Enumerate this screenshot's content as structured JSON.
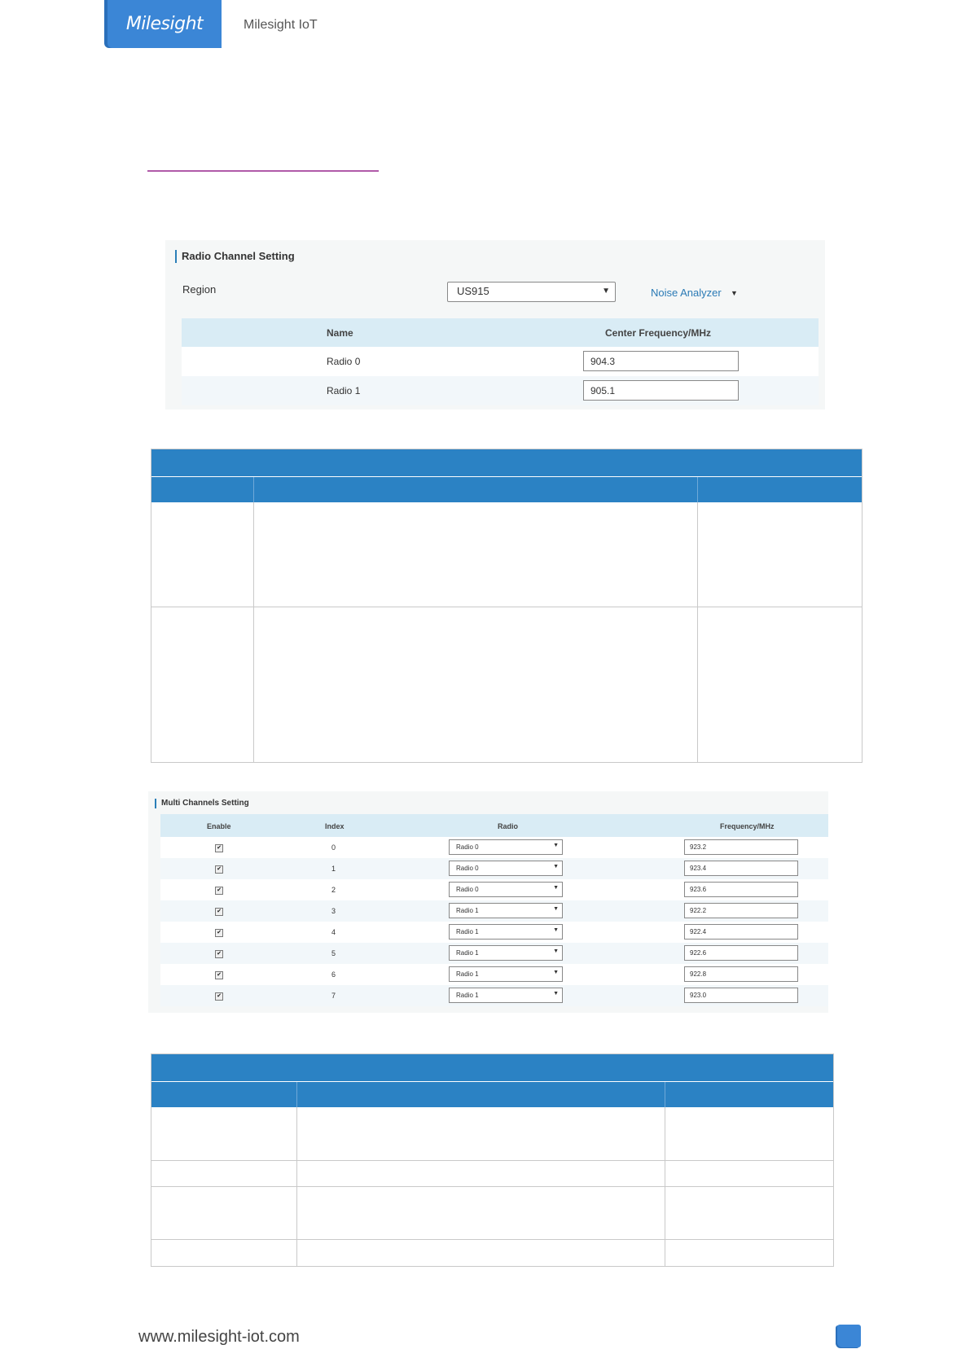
{
  "header": {
    "logo_text": "Milesight",
    "brand_name": "Milesight IoT"
  },
  "radio_channel_setting": {
    "title": "Radio Channel Setting",
    "region_label": "Region",
    "region_value": "US915",
    "noise_analyzer": "Noise Analyzer",
    "columns": {
      "name": "Name",
      "center_frequency": "Center Frequency/MHz"
    },
    "rows": [
      {
        "name": "Radio 0",
        "frequency": "904.3"
      },
      {
        "name": "Radio 1",
        "frequency": "905.1"
      }
    ]
  },
  "multi_channels_setting": {
    "title": "Multi Channels Setting",
    "columns": {
      "enable": "Enable",
      "index": "Index",
      "radio": "Radio",
      "frequency": "Frequency/MHz"
    },
    "rows": [
      {
        "enabled": true,
        "index": "0",
        "radio": "Radio 0",
        "frequency": "923.2"
      },
      {
        "enabled": true,
        "index": "1",
        "radio": "Radio 0",
        "frequency": "923.4"
      },
      {
        "enabled": true,
        "index": "2",
        "radio": "Radio 0",
        "frequency": "923.6"
      },
      {
        "enabled": true,
        "index": "3",
        "radio": "Radio 1",
        "frequency": "922.2"
      },
      {
        "enabled": true,
        "index": "4",
        "radio": "Radio 1",
        "frequency": "922.4"
      },
      {
        "enabled": true,
        "index": "5",
        "radio": "Radio 1",
        "frequency": "922.6"
      },
      {
        "enabled": true,
        "index": "6",
        "radio": "Radio 1",
        "frequency": "922.8"
      },
      {
        "enabled": true,
        "index": "7",
        "radio": "Radio 1",
        "frequency": "923.0"
      }
    ]
  },
  "footer": {
    "url": "www.milesight-iot.com"
  },
  "colors": {
    "brand_blue": "#3b86d6",
    "table_header_blue": "#2b82c4",
    "accent_purple": "#b05aa8",
    "link_blue": "#2a7ab5"
  }
}
